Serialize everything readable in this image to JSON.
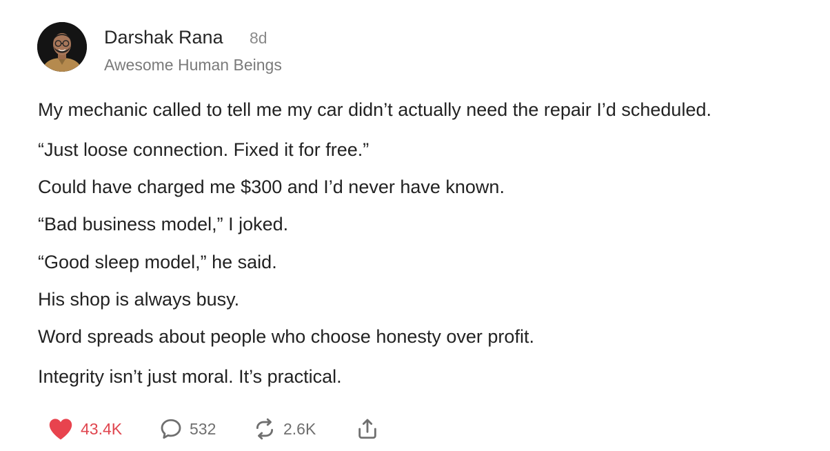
{
  "post": {
    "author": {
      "name": "Darshak Rana",
      "avatar_icon": "profile-photo"
    },
    "age": "8d",
    "community": "Awesome Human Beings",
    "body_lines": [
      "My mechanic called to tell me my car didn’t actually need the repair I’d scheduled.",
      "“Just loose connection. Fixed it for free.”",
      "Could have charged me $300 and I’d never have known.",
      "“Bad business model,” I joked.",
      "“Good sleep model,” he said.",
      "His shop is always busy.",
      "Word spreads about people who choose honesty over profit.",
      "Integrity isn’t just moral. It’s practical."
    ],
    "actions": {
      "likes": {
        "count": "43.4K",
        "icon": "heart-icon",
        "color": "#e8434e"
      },
      "comments": {
        "count": "532",
        "icon": "speech-bubble-icon"
      },
      "reposts": {
        "count": "2.6K",
        "icon": "repost-icon"
      },
      "share": {
        "icon": "share-icon"
      }
    }
  }
}
